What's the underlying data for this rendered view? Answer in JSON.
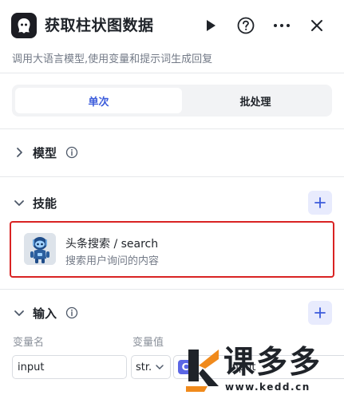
{
  "header": {
    "title": "获取柱状图数据",
    "description": "调用大语言模型,使用变量和提示词生成回复"
  },
  "mode_tabs": [
    {
      "label": "单次",
      "active": true
    },
    {
      "label": "批处理",
      "active": false
    }
  ],
  "sections": {
    "model": {
      "title": "模型"
    },
    "skills": {
      "title": "技能"
    },
    "input": {
      "title": "输入"
    }
  },
  "skill": {
    "name": "头条搜索 / search",
    "description": "搜索用户询问的内容"
  },
  "input_table": {
    "columns": [
      "变量名",
      "变量值"
    ],
    "row": {
      "name": "input",
      "type": "str.",
      "ref_prefix": "C",
      "ref_value": "input"
    }
  },
  "watermark": {
    "brand": "课多多",
    "url": "www.kedd.cn"
  },
  "colors": {
    "accent": "#3b5bdb",
    "highlight": "#d92323",
    "tag": "#5b66e5",
    "watermark_orange": "#f08a1c"
  }
}
